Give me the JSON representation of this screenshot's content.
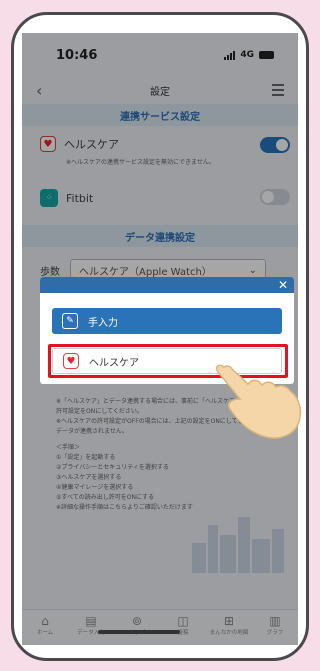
{
  "status": {
    "time": "10:46",
    "network": "4G"
  },
  "nav": {
    "title": "設定"
  },
  "sections": {
    "linked_services": "連携サービス設定",
    "data_link": "データ連携設定"
  },
  "services": [
    {
      "label": "ヘルスケア",
      "note": "※ヘルスケアの連携サービス設定を無効にできません。",
      "toggle": "on"
    },
    {
      "label": "Fitbit",
      "toggle": "off"
    }
  ],
  "steps": {
    "label": "歩数",
    "value": "ヘルスケア（Apple Watch）"
  },
  "info_text": [
    "※「ヘルスケア」とデータ連携する場合には、事前に「ヘルスケア」の",
    "許可設定をONにしてください。",
    "※ヘルスケアの許可設定がOFFの場合には、上記の設定をONにしても",
    "データが連携されません。",
    "",
    "＜手順＞",
    "①「設定」を起動する",
    "②プライバシーとセキュリティを選択する",
    "③ヘルスケアを選択する",
    "④健康マイレージを選択する",
    "⑤すべての読み出し許可をONにする",
    "※詳細な操作手順はこちらよりご確認いただけます"
  ],
  "tabs": [
    {
      "label": "ホーム",
      "icon": "home-icon"
    },
    {
      "label": "データ入力",
      "icon": "clipboard-icon"
    },
    {
      "label": "マップ",
      "icon": "map-pin-icon"
    },
    {
      "label": "投稿",
      "icon": "camera-icon"
    },
    {
      "label": "まんなかの地図",
      "icon": "grid-icon"
    },
    {
      "label": "グラフ",
      "icon": "chart-icon"
    }
  ],
  "modal": {
    "options": [
      {
        "label": "手入力",
        "icon": "pencil-icon"
      },
      {
        "label": "ヘルスケア",
        "icon": "heart-icon"
      }
    ]
  },
  "colors": {
    "accent": "#2a73b9",
    "highlight": "#e3121e",
    "background": "#f7dde8"
  }
}
